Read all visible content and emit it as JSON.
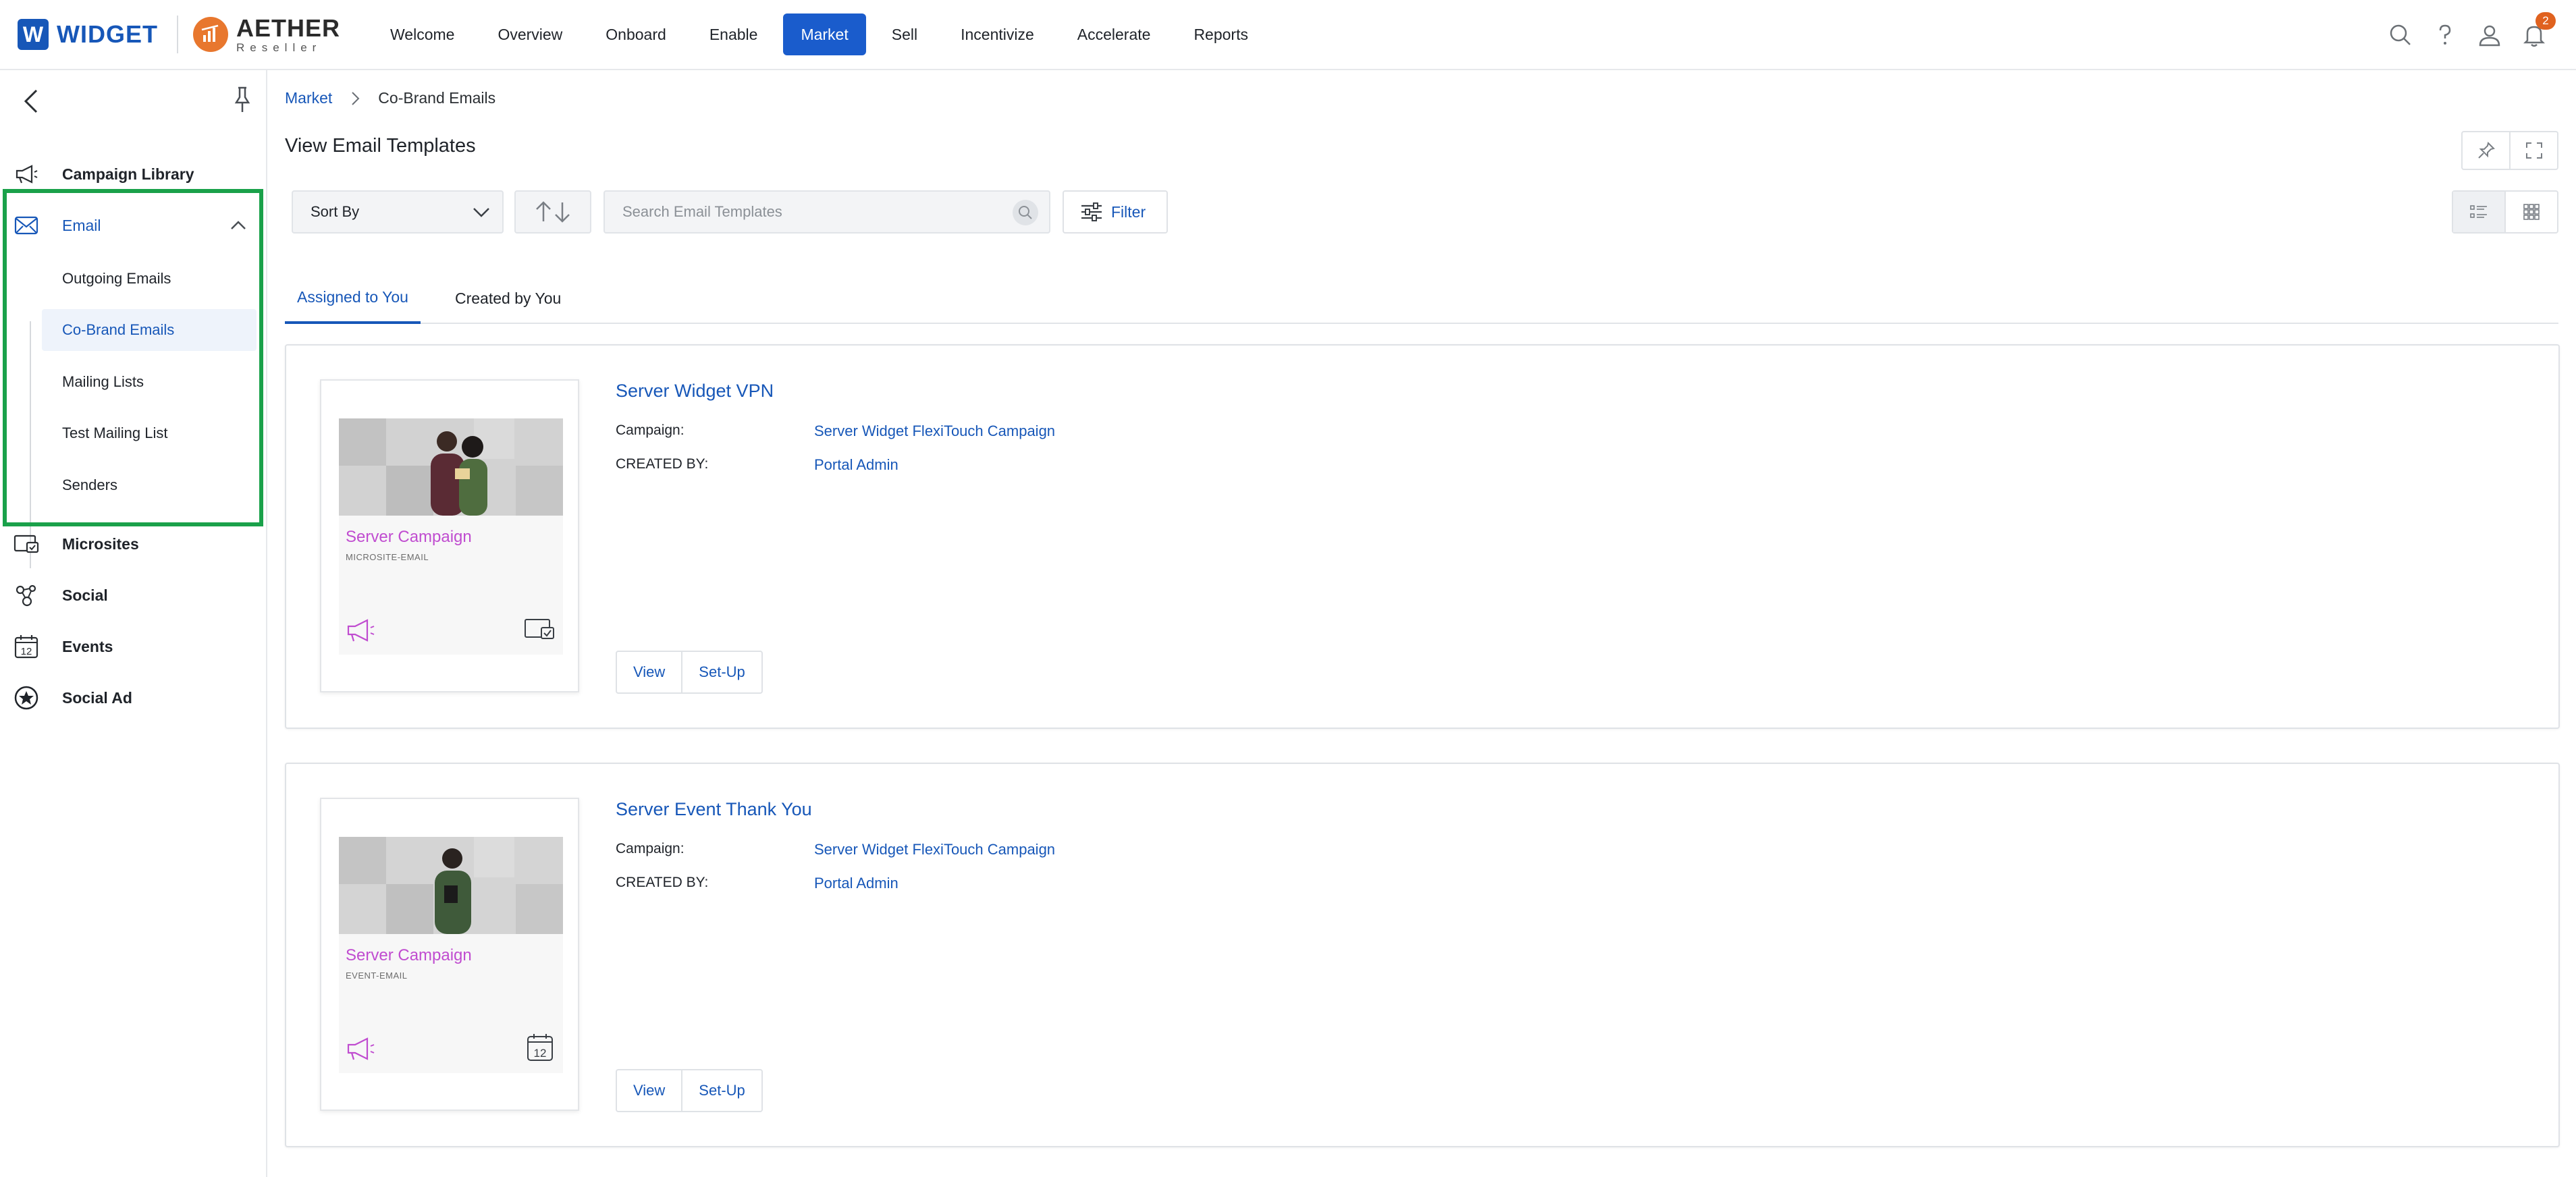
{
  "brand": {
    "widget": "WIDGET",
    "widget_letter": "W",
    "aether": "AETHER",
    "aether_sub": "Reseller"
  },
  "nav": {
    "items": [
      "Welcome",
      "Overview",
      "Onboard",
      "Enable",
      "Market",
      "Sell",
      "Incentivize",
      "Accelerate",
      "Reports"
    ],
    "active": "Market"
  },
  "notifications": {
    "count": "2"
  },
  "sidebar": {
    "items": {
      "campaign_library": "Campaign Library",
      "email": "Email",
      "microsites": "Microsites",
      "social": "Social",
      "events": "Events",
      "social_ad": "Social Ad"
    },
    "email_sub": [
      "Outgoing Emails",
      "Co-Brand Emails",
      "Mailing Lists",
      "Test Mailing List",
      "Senders"
    ],
    "active_sub": "Co-Brand Emails",
    "events_icon_day": "12"
  },
  "breadcrumb": {
    "parent": "Market",
    "current": "Co-Brand Emails"
  },
  "page": {
    "title": "View Email Templates"
  },
  "toolbar": {
    "sort_label": "Sort By",
    "search_placeholder": "Search Email Templates",
    "filter_label": "Filter"
  },
  "tabs": [
    {
      "label": "Assigned to You",
      "active": true
    },
    {
      "label": "Created by You",
      "active": false
    }
  ],
  "templates": [
    {
      "title": "Server Widget VPN",
      "campaign_label": "Campaign:",
      "campaign": "Server Widget FlexiTouch Campaign",
      "created_by_label": "CREATED BY:",
      "created_by": "Portal Admin",
      "thumb_title": "Server Campaign",
      "thumb_sub": "MICROSITE-EMAIL",
      "thumb_icon": "microsite-icon",
      "view_label": "View",
      "setup_label": "Set-Up"
    },
    {
      "title": "Server Event Thank You",
      "campaign_label": "Campaign:",
      "campaign": "Server Widget FlexiTouch Campaign",
      "created_by_label": "CREATED BY:",
      "created_by": "Portal Admin",
      "thumb_title": "Server Campaign",
      "thumb_sub": "EVENT-EMAIL",
      "thumb_icon": "calendar-icon",
      "thumb_icon_day": "12",
      "view_label": "View",
      "setup_label": "Set-Up"
    }
  ],
  "colors": {
    "accent": "#1757b8",
    "nav_active": "#1a5ccc",
    "highlight": "#1aa14a",
    "thumb_title": "#c04cd0",
    "badge": "#e0621f"
  }
}
